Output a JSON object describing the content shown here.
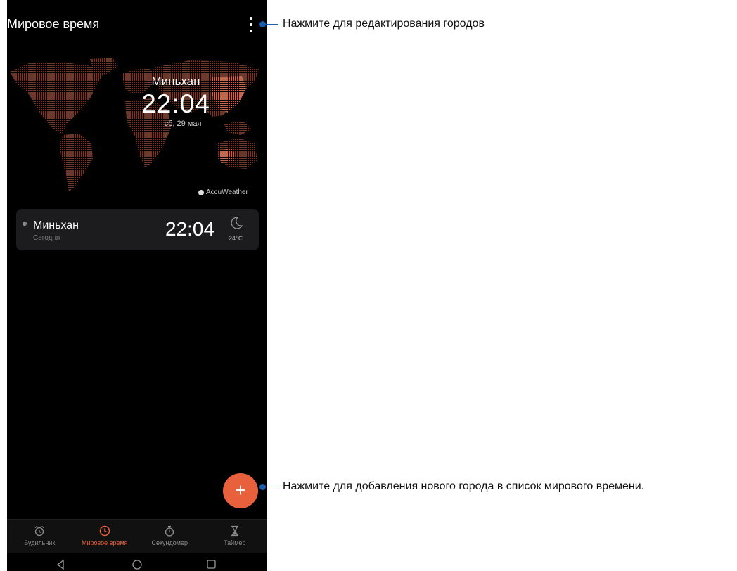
{
  "app": {
    "title": "Мировое время"
  },
  "hero": {
    "city": "Миньхан",
    "time": "22:04",
    "date": "сб, 29 мая"
  },
  "map": {
    "attribution": "AccuWeather",
    "dot_color": "#c0502e"
  },
  "city_list": [
    {
      "city": "Миньхан",
      "day": "Сегодня",
      "time": "22:04",
      "weather_icon": "moon-icon",
      "temp": "24℃"
    }
  ],
  "fab": {
    "label": "+"
  },
  "bottom_nav": [
    {
      "label": "Будильник",
      "icon": "alarm-clock-icon",
      "active": false
    },
    {
      "label": "Мировое время",
      "icon": "clock-icon",
      "active": true
    },
    {
      "label": "Секундомер",
      "icon": "stopwatch-icon",
      "active": false
    },
    {
      "label": "Таймер",
      "icon": "hourglass-icon",
      "active": false
    }
  ],
  "callouts": {
    "menu": "Нажмите для редактирования городов",
    "add": "Нажмите для добавления нового города в список мирового времени."
  },
  "colors": {
    "accent": "#e8603c",
    "callout": "#1a5cad",
    "background": "#000000"
  }
}
